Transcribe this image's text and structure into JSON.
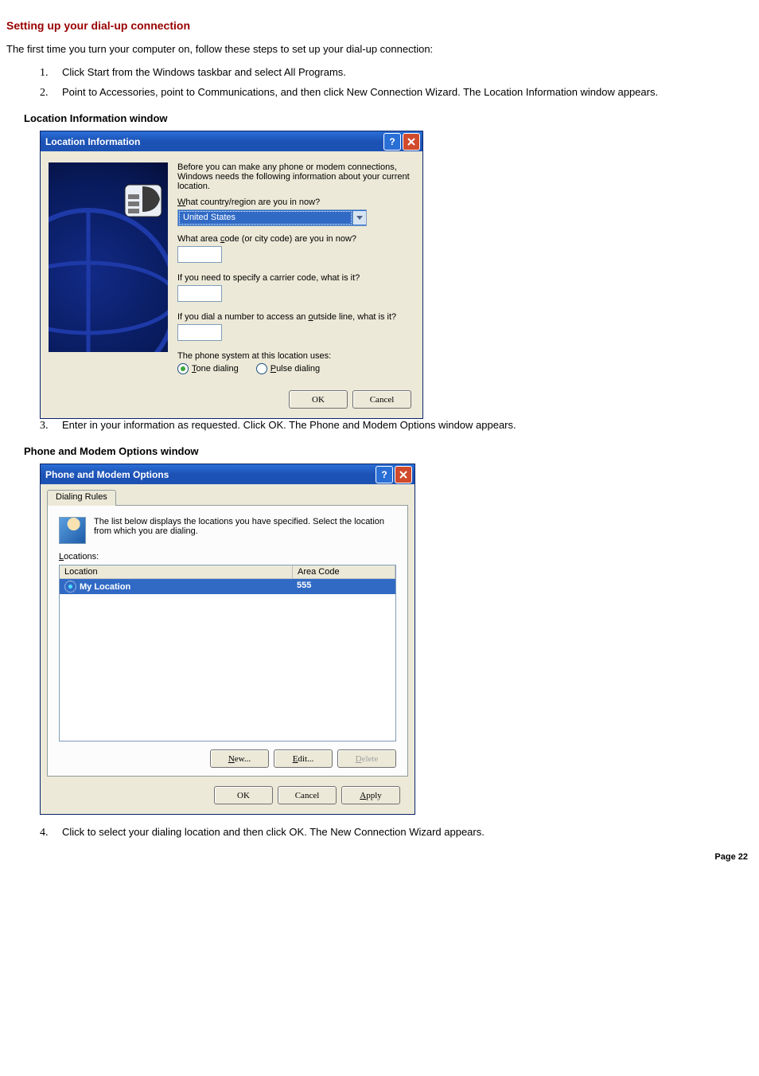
{
  "heading": "Setting up your dial-up connection",
  "intro": "The first time you turn your computer on, follow these steps to set up your dial-up connection:",
  "steps": {
    "s1": "Click Start from the Windows taskbar and select All Programs.",
    "s2": "Point to Accessories, point to Communications, and then click New Connection Wizard. The Location Information window appears.",
    "s3": "Enter in your information as requested. Click OK. The Phone and Modem Options window appears.",
    "s4": "Click to select your dialing location and then click OK. The New Connection Wizard appears."
  },
  "caption1": "Location Information window",
  "caption2": "Phone and Modem Options window",
  "loc": {
    "title": "Location Information",
    "intro": "Before you can make any phone or modem connections, Windows needs the following information about your current location.",
    "q_country_pre": "What country/region are you in now?",
    "q_country_u": "W",
    "country_value": "United States",
    "q_area_pre": "What area ",
    "q_area_u": "c",
    "q_area_post": "ode (or city code) are you in now?",
    "q_carrier": "If you need to specify a carrier code, what is it?",
    "q_outside_pre": "If you dial a number to access an ",
    "q_outside_u": "o",
    "q_outside_post": "utside line, what is it?",
    "q_phonesys": "The phone system at this location uses:",
    "tone_u": "T",
    "tone_post": "one dialing",
    "pulse_u": "P",
    "pulse_post": "ulse dialing",
    "ok": "OK",
    "cancel": "Cancel"
  },
  "pm": {
    "title": "Phone and Modem Options",
    "tab": "Dialing Rules",
    "intro": "The list below displays the locations you have specified. Select the location from which you are dialing.",
    "loc_u": "L",
    "loc_post": "ocations:",
    "col_location": "Location",
    "col_area": "Area Code",
    "row_name": "My Location",
    "row_code": "555",
    "new_u": "N",
    "new_post": "ew...",
    "edit_u": "E",
    "edit_post": "dit...",
    "del_u": "D",
    "del_post": "elete",
    "ok": "OK",
    "cancel": "Cancel",
    "apply_u": "A",
    "apply_post": "pply"
  },
  "pagenum": "Page 22"
}
